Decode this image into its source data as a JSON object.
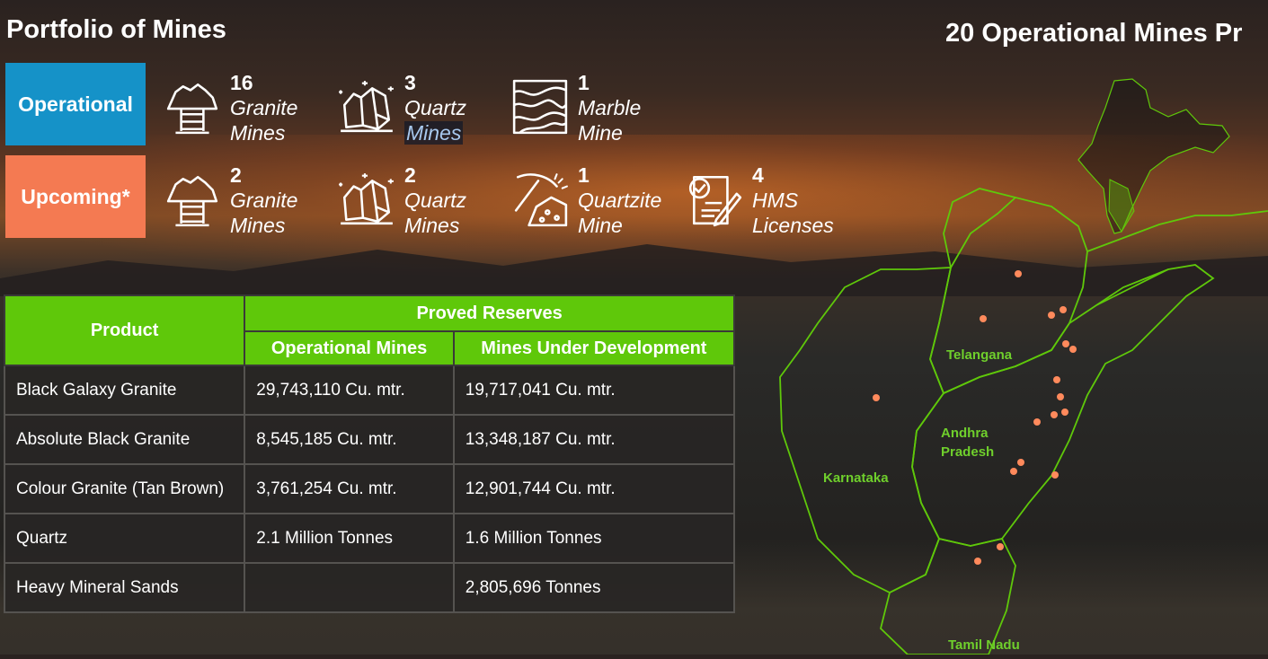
{
  "title": "Portfolio of Mines",
  "map_title": "20 Operational Mines Pr",
  "operational": {
    "label": "Operational",
    "items": [
      {
        "count": "16",
        "line1": "Granite",
        "line2": "Mines",
        "icon": "granite-mine-icon"
      },
      {
        "count": "3",
        "line1": "Quartz",
        "line2": "Mines",
        "icon": "quartz-crystal-icon"
      },
      {
        "count": "1",
        "line1": "Marble",
        "line2": "Mine",
        "icon": "marble-slab-icon"
      }
    ]
  },
  "upcoming": {
    "label": "Upcoming*",
    "items": [
      {
        "count": "2",
        "line1": "Granite",
        "line2": "Mines",
        "icon": "granite-mine-icon"
      },
      {
        "count": "2",
        "line1": "Quartz",
        "line2": "Mines",
        "icon": "quartz-crystal-icon"
      },
      {
        "count": "1",
        "line1": "Quartzite",
        "line2": "Mine",
        "icon": "pickaxe-icon"
      },
      {
        "count": "4",
        "line1": "HMS",
        "line2": "Licenses",
        "icon": "license-document-icon"
      }
    ]
  },
  "table": {
    "header_product": "Product",
    "header_group": "Proved Reserves",
    "header_operational": "Operational Mines",
    "header_development": "Mines Under Development",
    "rows": [
      {
        "product": "Black Galaxy Granite",
        "operational": "29,743,110 Cu. mtr.",
        "development": "19,717,041 Cu. mtr."
      },
      {
        "product": "Absolute Black Granite",
        "operational": "8,545,185 Cu. mtr.",
        "development": "13,348,187 Cu. mtr."
      },
      {
        "product": "Colour Granite (Tan Brown)",
        "operational": "3,761,254 Cu. mtr.",
        "development": "12,901,744 Cu. mtr."
      },
      {
        "product": "Quartz",
        "operational": "2.1 Million Tonnes",
        "development": "1.6 Million Tonnes"
      },
      {
        "product": "Heavy Mineral Sands",
        "operational": "",
        "development": "2,805,696 Tonnes"
      }
    ]
  },
  "map": {
    "labels": {
      "telangana": "Telangana",
      "andhra_line1": "Andhra",
      "andhra_line2": "Pradesh",
      "karnataka": "Karnataka",
      "tamil_nadu": "Tamil Nadu"
    },
    "colors": {
      "border": "#5fc80a",
      "dot": "#ff8a5c",
      "label": "#6fcf2c"
    }
  }
}
